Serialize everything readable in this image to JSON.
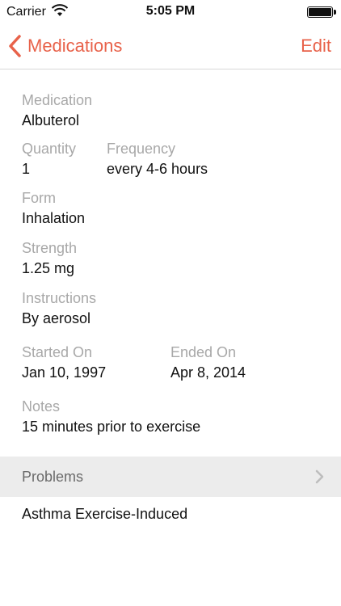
{
  "status_bar": {
    "carrier": "Carrier",
    "time": "5:05 PM"
  },
  "nav": {
    "back_label": "Medications",
    "edit_label": "Edit",
    "accent_color": "#e8624a"
  },
  "details": {
    "medication": {
      "label": "Medication",
      "value": "Albuterol"
    },
    "quantity": {
      "label": "Quantity",
      "value": "1"
    },
    "frequency": {
      "label": "Frequency",
      "value": "every 4-6 hours"
    },
    "form": {
      "label": "Form",
      "value": "Inhalation"
    },
    "strength": {
      "label": "Strength",
      "value": "1.25 mg"
    },
    "instructions": {
      "label": "Instructions",
      "value": "By aerosol"
    },
    "started_on": {
      "label": "Started On",
      "value": "Jan 10, 1997"
    },
    "ended_on": {
      "label": "Ended On",
      "value": "Apr 8, 2014"
    },
    "notes": {
      "label": "Notes",
      "value": "15 minutes prior to exercise"
    }
  },
  "problems": {
    "title": "Problems",
    "items": [
      "Asthma Exercise-Induced"
    ]
  }
}
